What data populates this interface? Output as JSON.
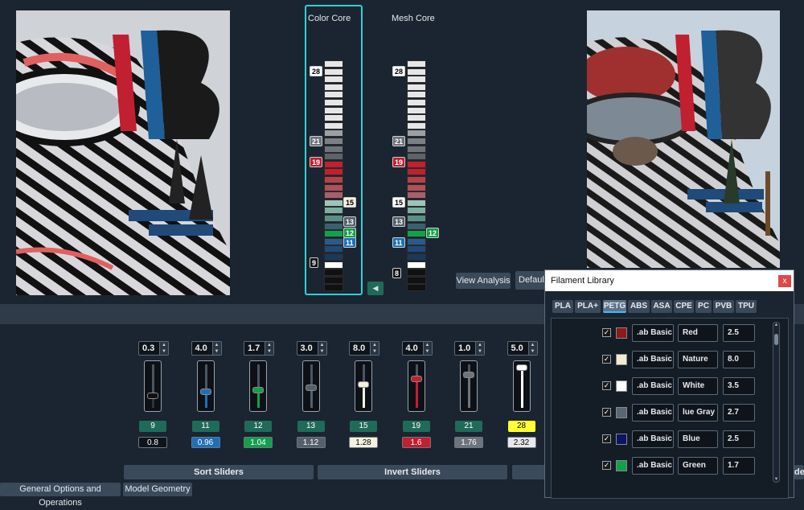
{
  "cores": {
    "color_core_label": "Color Core",
    "mesh_core_label": "Mesh Core"
  },
  "color_core_markers": [
    {
      "label": "28",
      "color": "#ffffff",
      "text": "#000"
    },
    {
      "label": "21",
      "color": "#6e747b",
      "text": "#fff"
    },
    {
      "label": "19",
      "color": "#c0202f",
      "text": "#fff"
    },
    {
      "label": "15",
      "color": "#f7f1df",
      "text": "#000"
    },
    {
      "label": "13",
      "color": "#55606c",
      "text": "#fff"
    },
    {
      "label": "12",
      "color": "#12a04a",
      "text": "#fff"
    },
    {
      "label": "11",
      "color": "#1f6fb8",
      "text": "#fff"
    },
    {
      "label": "9",
      "color": "#111111",
      "text": "#fff"
    }
  ],
  "mesh_core_markers": [
    {
      "label": "28",
      "color": "#ffffff",
      "text": "#000"
    },
    {
      "label": "21",
      "color": "#6e747b",
      "text": "#fff"
    },
    {
      "label": "19",
      "color": "#c0202f",
      "text": "#fff"
    },
    {
      "label": "15",
      "color": "#ffffff",
      "text": "#000"
    },
    {
      "label": "13",
      "color": "#55606c",
      "text": "#fff"
    },
    {
      "label": "12",
      "color": "#12a04a",
      "text": "#fff"
    },
    {
      "label": "11",
      "color": "#1f6fb8",
      "text": "#fff"
    },
    {
      "label": "8",
      "color": "#111111",
      "text": "#fff"
    }
  ],
  "buttons": {
    "view_analysis": "View Analysis",
    "default": "Default",
    "sort_sliders": "Sort Sliders",
    "invert_sliders": "Invert Sliders",
    "partial_right": "de"
  },
  "tabs_bottom": {
    "general": "General Options and Operations",
    "model_geometry": "Model Geometry"
  },
  "sliders": [
    {
      "spin": "0.3",
      "label": "9",
      "label_color": "#1f6b5a",
      "label_text": "#fff",
      "value": "0.8",
      "value_bg": "#0f141b",
      "value_text": "#fff",
      "knob": "#111111",
      "level": 0.25
    },
    {
      "spin": "4.0",
      "label": "11",
      "label_color": "#1f6b5a",
      "label_text": "#fff",
      "value": "0.96",
      "value_bg": "#1f6fb8",
      "value_text": "#fff",
      "knob": "#1f6fb8",
      "level": 0.35
    },
    {
      "spin": "1.7",
      "label": "12",
      "label_color": "#1f6b5a",
      "label_text": "#fff",
      "value": "1.04",
      "value_bg": "#12a04a",
      "value_text": "#fff",
      "knob": "#12a04a",
      "level": 0.4
    },
    {
      "spin": "3.0",
      "label": "13",
      "label_color": "#1f6b5a",
      "label_text": "#fff",
      "value": "1.12",
      "value_bg": "#55606c",
      "value_text": "#fff",
      "knob": "#55606c",
      "level": 0.45
    },
    {
      "spin": "8.0",
      "label": "15",
      "label_color": "#1f6b5a",
      "label_text": "#fff",
      "value": "1.28",
      "value_bg": "#f7f1df",
      "value_text": "#000",
      "knob": "#f7f1df",
      "level": 0.55
    },
    {
      "spin": "4.0",
      "label": "19",
      "label_color": "#1f6b5a",
      "label_text": "#fff",
      "value": "1.6",
      "value_bg": "#c0202f",
      "value_text": "#fff",
      "knob": "#c0202f",
      "level": 0.7
    },
    {
      "spin": "1.0",
      "label": "21",
      "label_color": "#1f6b5a",
      "label_text": "#fff",
      "value": "1.76",
      "value_bg": "#6e747b",
      "value_text": "#fff",
      "knob": "#6e747b",
      "level": 0.8
    },
    {
      "spin": "5.0",
      "label": "28",
      "label_color": "#ffff33",
      "label_text": "#000",
      "value": "2.32",
      "value_bg": "#e9e9e9",
      "value_text": "#000",
      "knob": "#ffffff",
      "level": 1.0
    }
  ],
  "filament_dialog": {
    "title": "Filament Library",
    "close": "x",
    "tabs": [
      "PLA",
      "PLA+",
      "PETG",
      "ABS",
      "ASA",
      "CPE",
      "PC",
      "PVB",
      "TPU"
    ],
    "active_tab": "PETG",
    "rows": [
      {
        "checked": "✓",
        "swatch": "#8b1a1a",
        "brand": ".ab Basic",
        "name": "Red",
        "td": "2.5"
      },
      {
        "checked": "✓",
        "swatch": "#f3ead5",
        "brand": ".ab Basic",
        "name": "Nature",
        "td": "8.0"
      },
      {
        "checked": "✓",
        "swatch": "#ffffff",
        "brand": ".ab Basic",
        "name": "White",
        "td": "3.5"
      },
      {
        "checked": "✓",
        "swatch": "#5b6673",
        "brand": ".ab Basic",
        "name": "lue Gray",
        "td": "2.7"
      },
      {
        "checked": "✓",
        "swatch": "#0b1466",
        "brand": ".ab Basic",
        "name": "Blue",
        "td": "2.5"
      },
      {
        "checked": "✓",
        "swatch": "#12a04a",
        "brand": ".ab Basic",
        "name": "Green",
        "td": "1.7"
      }
    ]
  }
}
